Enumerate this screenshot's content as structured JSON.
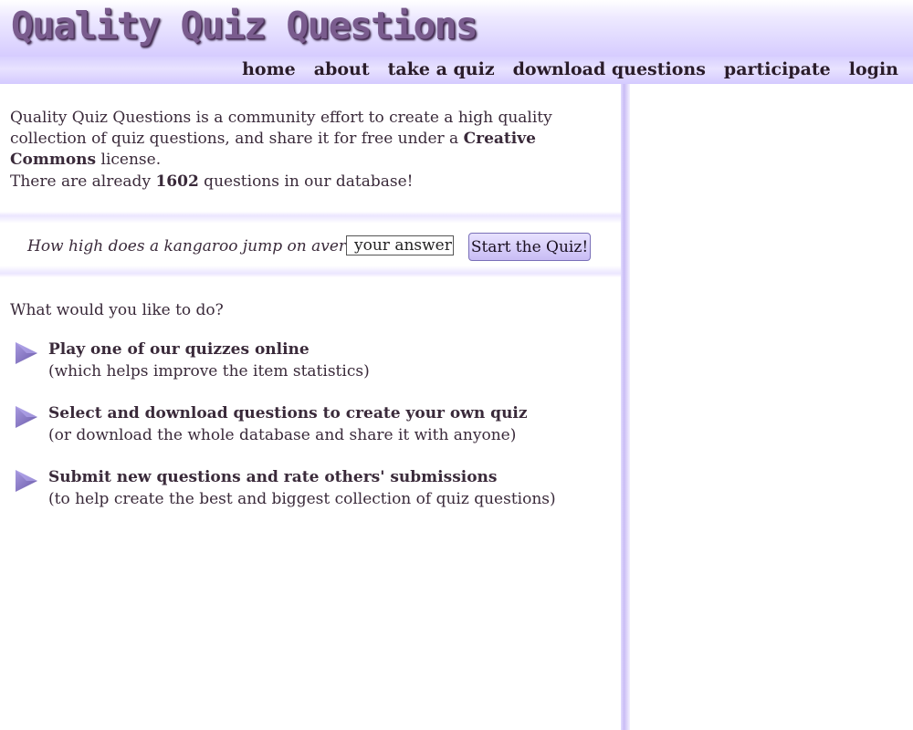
{
  "header": {
    "logo_text": "Quality Quiz Questions"
  },
  "nav": {
    "items": [
      {
        "label": "home"
      },
      {
        "label": "about"
      },
      {
        "label": "take a quiz"
      },
      {
        "label": "download questions"
      },
      {
        "label": "participate"
      },
      {
        "label": "login"
      }
    ]
  },
  "main": {
    "intro_before": "Quality Quiz Questions is a community effort to create a high quality collection of quiz questions, and share it for free under a ",
    "intro_bold": "Creative Commons",
    "intro_after": " license.",
    "count_before": "There are already ",
    "count_value": "1602",
    "count_after": " questions in our database!",
    "quiz": {
      "question": "How high does a kangaroo jump on average?",
      "input_value": "your answer",
      "button_label": "Start the Quiz!"
    },
    "prompt": "What would you like to do?",
    "actions": [
      {
        "title": "Play one of our quizzes online",
        "subtitle": "(which helps improve the item statistics)"
      },
      {
        "title": "Select and download questions to create your own quiz",
        "subtitle": "(or download the whole database and share it with anyone)"
      },
      {
        "title": "Submit new questions and rate others' submissions",
        "subtitle": "(to help create the best and biggest collection of quiz questions)"
      }
    ]
  },
  "colors": {
    "accent": "#c8bcf4",
    "arrow": "#8070c0",
    "text": "#3a2a3a"
  },
  "icons": {
    "action_arrow": "play-arrow-icon"
  }
}
